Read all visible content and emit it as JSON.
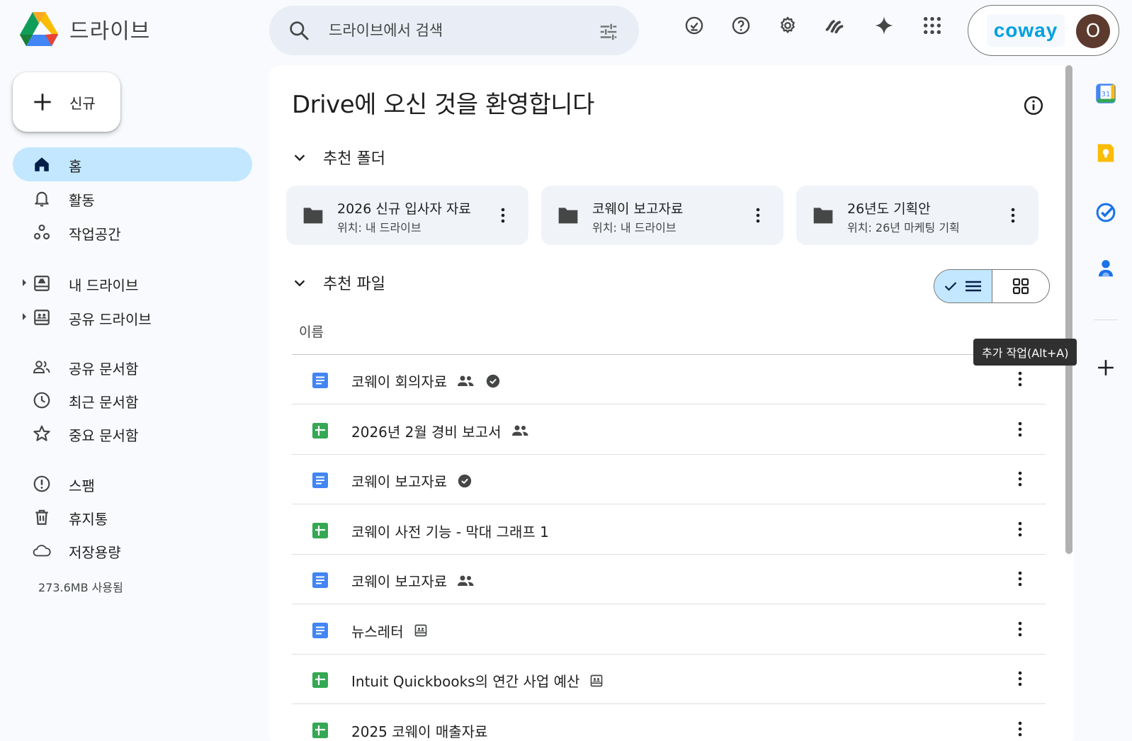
{
  "app": {
    "title": "드라이브"
  },
  "search": {
    "placeholder": "드라이브에서 검색"
  },
  "header_icons": [
    "ready-for-offline-icon",
    "help-icon",
    "settings-icon",
    "gemini-workspace-icon",
    "gemini-spark-icon",
    "apps-grid-icon"
  ],
  "account": {
    "brand": "coway",
    "avatar_initial": "O"
  },
  "sidebar": {
    "new_label": "신규",
    "items": [
      {
        "label": "홈",
        "icon": "home-icon"
      },
      {
        "label": "활동",
        "icon": "bell-icon"
      },
      {
        "label": "작업공간",
        "icon": "workspaces-icon"
      },
      {
        "label": "내 드라이브",
        "icon": "my-drive-icon"
      },
      {
        "label": "공유 드라이브",
        "icon": "shared-drive-icon"
      },
      {
        "label": "공유 문서함",
        "icon": "people-icon"
      },
      {
        "label": "최근 문서함",
        "icon": "clock-icon"
      },
      {
        "label": "중요 문서함",
        "icon": "star-icon"
      },
      {
        "label": "스팸",
        "icon": "spam-icon"
      },
      {
        "label": "휴지통",
        "icon": "trash-icon"
      },
      {
        "label": "저장용량",
        "icon": "cloud-icon"
      }
    ],
    "storage_used": "273.6MB 사용됨"
  },
  "main": {
    "welcome": "Drive에 오신 것을 환영합니다",
    "folders_title": "추천 폴더",
    "folders": [
      {
        "name": "2026 신규 입사자 자료",
        "location": "위치: 내 드라이브"
      },
      {
        "name": "코웨이 보고자료",
        "location": "위치: 내 드라이브"
      },
      {
        "name": "26년도 기획안",
        "location": "위치: 26년 마케팅 기획"
      }
    ],
    "files_title": "추천 파일",
    "column_name": "이름",
    "files": [
      {
        "name": "코웨이 회의자료",
        "type": "docs",
        "badges": [
          "shared-icon",
          "approval-icon"
        ]
      },
      {
        "name": "2026년 2월 경비 보고서",
        "type": "sheets",
        "badges": [
          "shared-icon"
        ]
      },
      {
        "name": "코웨이 보고자료",
        "type": "docs",
        "badges": [
          "approval-icon"
        ]
      },
      {
        "name": "코웨이 사전 기능 - 막대 그래프 1",
        "type": "sheets",
        "badges": []
      },
      {
        "name": "코웨이 보고자료",
        "type": "docs",
        "badges": [
          "shared-icon"
        ]
      },
      {
        "name": "뉴스레터",
        "type": "docs",
        "badges": [
          "shared-drive-icon"
        ]
      },
      {
        "name": "Intuit Quickbooks의 연간 사업 예산",
        "type": "sheets",
        "badges": [
          "shared-drive-icon"
        ]
      },
      {
        "name": "2025 코웨이 매출자료",
        "type": "sheets",
        "badges": []
      }
    ]
  },
  "tooltip": "추가 작업(Alt+A)",
  "side_panel": [
    "calendar-icon",
    "keep-icon",
    "tasks-icon",
    "contacts-icon",
    "add-icon"
  ],
  "colors": {
    "docs": "#4285f4",
    "sheets": "#34a853",
    "active_nav": "#c2e7ff",
    "search_bg": "#e9eef6"
  }
}
